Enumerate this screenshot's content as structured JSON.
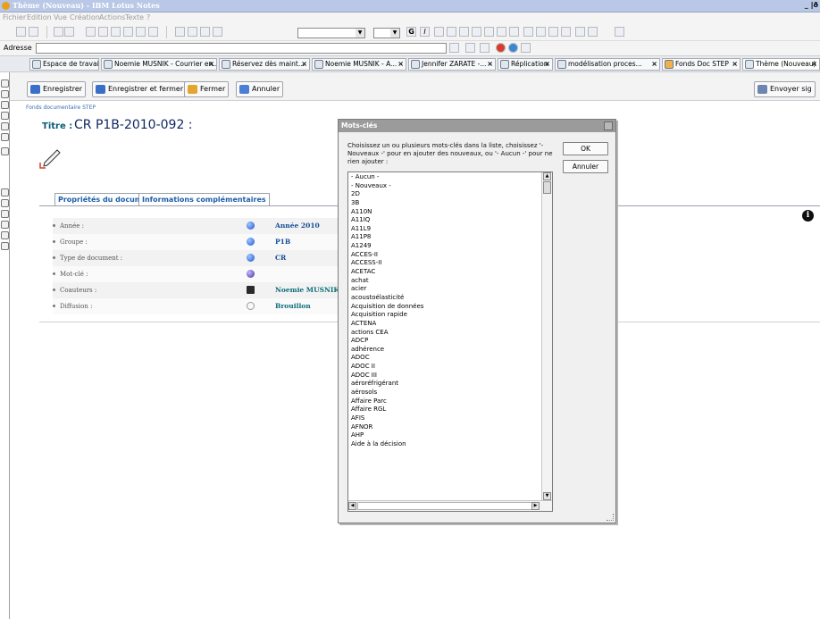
{
  "window": {
    "title": "Thème (Nouveau) - IBM Lotus Notes",
    "controls": "_ |ð"
  },
  "menu": [
    "Fichier",
    "Edition",
    "Vue",
    "Création",
    "Actions",
    "Texte",
    "?"
  ],
  "address": {
    "label": "Adresse",
    "value": ""
  },
  "tabs": [
    "Espace de travail",
    "Noemie MUSNIK - Courrier en...",
    "Réservez dès maint...",
    "Noemie MUSNIK - A...",
    "Jennifer ZARATE -...",
    "Réplication",
    "modélisation proces...",
    "Fonds Doc STEP",
    "Thème (Nouveau)"
  ],
  "actions": {
    "save": "Enregistrer",
    "save_close": "Enregistrer et fermer",
    "close": "Fermer",
    "cancel": "Annuler",
    "send": "Envoyer sig"
  },
  "document": {
    "breadcrumb": "Fonds documentaire STEP",
    "title_label": "Titre :",
    "title_value": "CR P1B-2010-092 :",
    "prop_tabs": [
      "Propriétés du document",
      "Informations complémentaires"
    ],
    "properties": [
      {
        "label": "Année :",
        "value": "Année 2010",
        "icon": "blue-globe-icon"
      },
      {
        "label": "Groupe :",
        "value": "P1B",
        "icon": "blue-globe-icon"
      },
      {
        "label": "Type de document :",
        "value": "CR",
        "icon": "blue-globe-icon"
      },
      {
        "label": "Mot-clé :",
        "value": "",
        "icon": "purple-globe-icon"
      },
      {
        "label": "Coauteurs :",
        "value": "Noemie MUSNIK/",
        "icon": "people-icon"
      },
      {
        "label": "Diffusion :",
        "value": "Brouillon",
        "icon": "refresh-icon"
      }
    ]
  },
  "dialog": {
    "title": "Mots-clés",
    "description": "Choisissez un ou plusieurs mots-clés dans la liste, choisissez '- Nouveaux -' pour en ajouter des nouveaux, ou '- Aucun -' pour ne rien ajouter :",
    "ok": "OK",
    "cancel": "Annuler",
    "items": [
      "- Aucun -",
      "- Nouveaux -",
      "2D",
      "3B",
      "A110N",
      "A11IQ",
      "A11L9",
      "A11P8",
      "A1249",
      "ACCES-II",
      "ACCESS-II",
      "ACETAC",
      "achat",
      "acier",
      "acoustoélasticité",
      "Acquisition de données",
      "Acquisition rapide",
      "ACTENA",
      "actions CEA",
      "ADCP",
      "adhérence",
      "ADOC",
      "ADOC II",
      "ADOC III",
      "aéroréfrigérant",
      "aérosols",
      "Affaire Parc",
      "Affaire RGL",
      "AFIS",
      "AFNOR",
      "AHP",
      "Aide à la décision"
    ]
  },
  "colors": {
    "link_blue": "#134e96",
    "title_navy": "#102860",
    "tab_blue": "#1c5ea8"
  }
}
